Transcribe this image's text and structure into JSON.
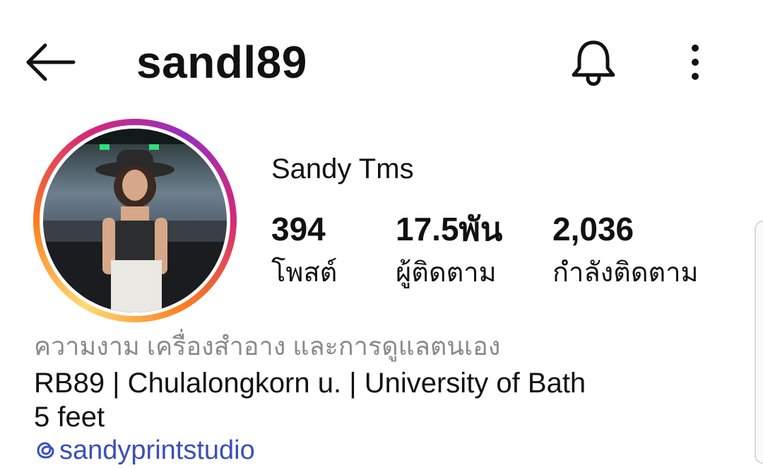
{
  "header": {
    "username": "sandl89",
    "back_icon": "arrow-left-icon",
    "bell_icon": "bell-icon",
    "more_icon": "more-vertical-icon"
  },
  "profile": {
    "display_name": "Sandy Tms",
    "avatar_icon": "profile-photo",
    "ring_colors": [
      "#feda75",
      "#fa7e1e",
      "#d62976",
      "#962fbf"
    ],
    "stats": {
      "posts": {
        "value": "394",
        "label": "โพสต์"
      },
      "followers": {
        "value": "17.5พัน",
        "label": "ผู้ติดตาม"
      },
      "following": {
        "value": "2,036",
        "label": "กำลังติดตาม"
      }
    }
  },
  "bio": {
    "category": "ความงาม เครื่องสำอาง และการดูแลตนเอง",
    "line1": "RB89 | Chulalongkorn u. | University of Bath",
    "line2": "5 feet",
    "threads_handle": "sandyprintstudio",
    "threads_icon": "threads-icon",
    "link_color": "#3b4fb8"
  }
}
